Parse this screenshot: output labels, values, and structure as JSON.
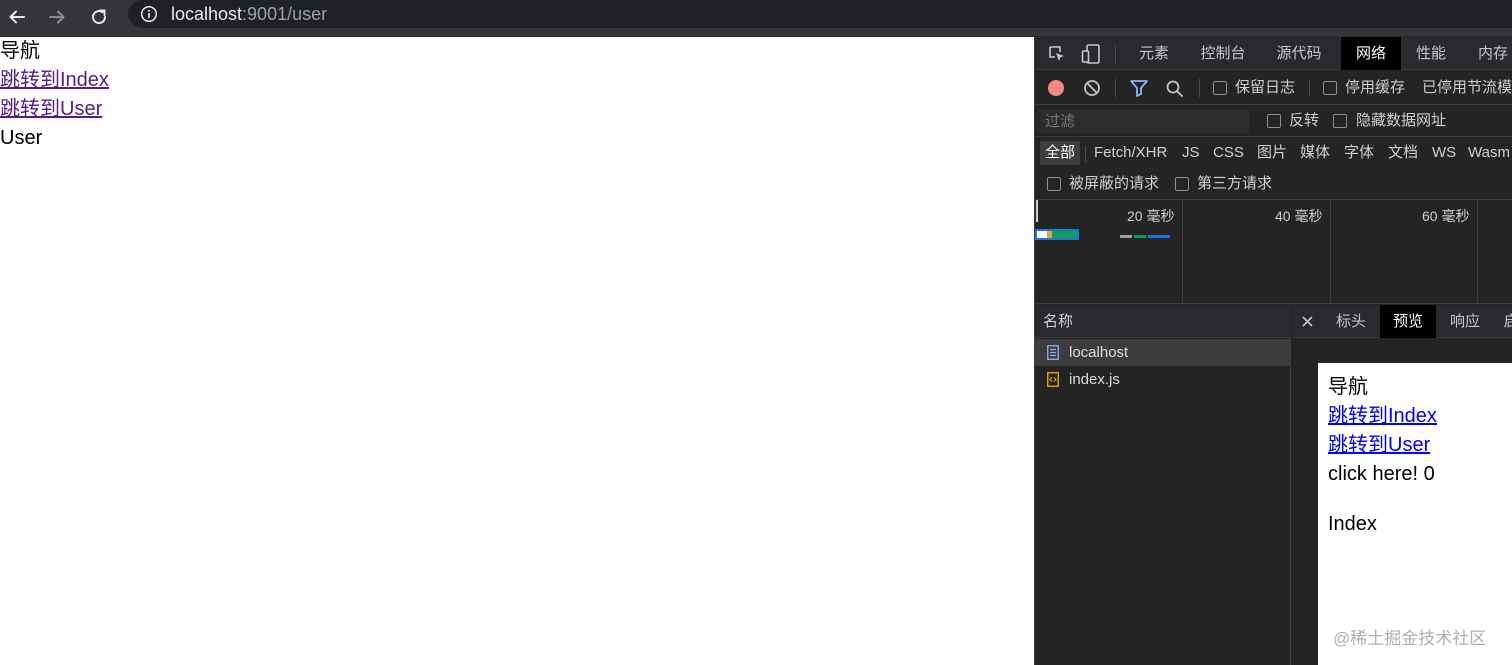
{
  "browser": {
    "url_host": "localhost",
    "url_rest": ":9001/user"
  },
  "page": {
    "nav_title": "导航",
    "link_index": "跳转到Index",
    "link_user": "跳转到User",
    "content": "User"
  },
  "devtools": {
    "tabs": [
      "元素",
      "控制台",
      "源代码",
      "网络",
      "性能",
      "内存"
    ],
    "active_tab": "网络",
    "toolbar": {
      "preserve_log": "保留日志",
      "disable_cache": "停用缓存",
      "throttling": "已停用节流模"
    },
    "filter": {
      "placeholder": "过滤",
      "invert": "反转",
      "hide_data_urls": "隐藏数据网址"
    },
    "types": [
      "全部",
      "Fetch/XHR",
      "JS",
      "CSS",
      "图片",
      "媒体",
      "字体",
      "文档",
      "WS",
      "Wasm"
    ],
    "blocked_requests": "被屏蔽的请求",
    "third_party": "第三方请求",
    "timeline_labels": [
      "20 毫秒",
      "40 毫秒",
      "60 毫秒"
    ],
    "name_header": "名称",
    "requests": [
      {
        "name": "localhost",
        "type": "document-icon"
      },
      {
        "name": "index.js",
        "type": "script-icon"
      }
    ],
    "detail_tabs": [
      "标头",
      "预览",
      "响应",
      "启"
    ],
    "active_detail_tab": "预览",
    "preview": {
      "nav_title": "导航",
      "link_index": "跳转到Index",
      "link_user": "跳转到User",
      "click_text": "click here! 0",
      "content": "Index"
    }
  },
  "watermark": "@稀土掘金技术社区",
  "colors": {
    "visited_link": "#551a8b",
    "preview_link": "#0000ee",
    "record_button": "#f28b82",
    "filter_icon": "#8ab4f8"
  }
}
